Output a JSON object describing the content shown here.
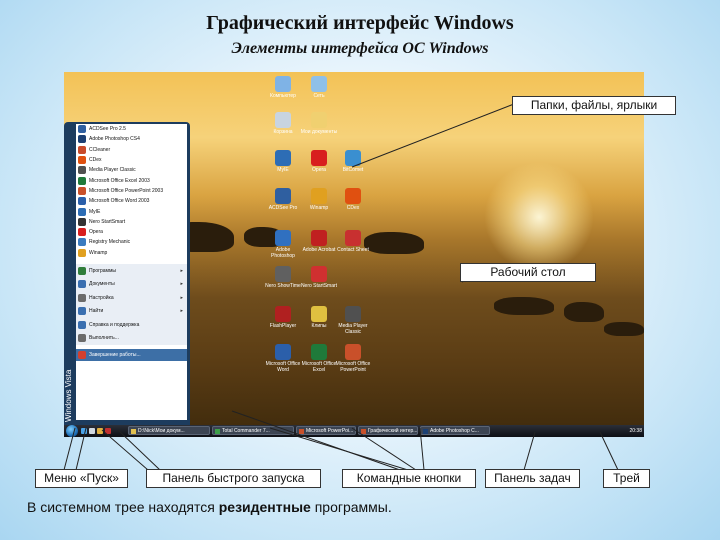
{
  "title": "Графический интерфейс Windows",
  "subtitle": "Элементы интерфейса ОС Windows",
  "desktop": {
    "icons": [
      {
        "label": "Компьютер",
        "color": "#7fb3e6"
      },
      {
        "label": "Сеть",
        "color": "#8fc0e8"
      },
      {
        "label": "Корзина",
        "color": "#c8d4e0"
      },
      {
        "label": "Мои документы",
        "color": "#f0d070"
      },
      {
        "label": "MyIE",
        "color": "#2d6db5"
      },
      {
        "label": "Opera",
        "color": "#d81e1e"
      },
      {
        "label": "BitComet",
        "color": "#3a8fd0"
      },
      {
        "label": "ACDSee Pro",
        "color": "#2f5fa0"
      },
      {
        "label": "Winamp",
        "color": "#e0a020"
      },
      {
        "label": "CDex",
        "color": "#e05010"
      },
      {
        "label": "Adobe Photoshop",
        "color": "#3070c0"
      },
      {
        "label": "Adobe Acrobat",
        "color": "#c02020"
      },
      {
        "label": "Contact Sheet",
        "color": "#c83030"
      },
      {
        "label": "Nero ShowTime",
        "color": "#606060"
      },
      {
        "label": "Nero StartSmart",
        "color": "#d03030"
      },
      {
        "label": "FlashPlayer",
        "color": "#b02020"
      },
      {
        "label": "Клипы",
        "color": "#e0c040"
      },
      {
        "label": "Media Player Classic",
        "color": "#505050"
      },
      {
        "label": "Microsoft Office Word",
        "color": "#2b5faa"
      },
      {
        "label": "Microsoft Office Excel",
        "color": "#1f7a3a"
      },
      {
        "label": "Microsoft Office PowerPoint",
        "color": "#c9502a"
      }
    ]
  },
  "start_menu": {
    "side_label": "Windows Vista",
    "items": [
      {
        "label": "ACDSee Pro 2.5",
        "color": "#2f5fa0"
      },
      {
        "label": "Adobe Photoshop CS4",
        "color": "#1b3f73"
      },
      {
        "label": "CCleaner",
        "color": "#c84a2a"
      },
      {
        "label": "CDex",
        "color": "#e05010"
      },
      {
        "label": "Media Player Classic",
        "color": "#505050"
      },
      {
        "label": "Microsoft Office Excel 2003",
        "color": "#1f7a3a"
      },
      {
        "label": "Microsoft Office PowerPoint 2003",
        "color": "#c9502a"
      },
      {
        "label": "Microsoft Office Word 2003",
        "color": "#2b5faa"
      },
      {
        "label": "MyIE",
        "color": "#2d6db5"
      },
      {
        "label": "Nero StartSmart",
        "color": "#333333"
      },
      {
        "label": "Opera",
        "color": "#d81e1e"
      },
      {
        "label": "Registry Mechanic",
        "color": "#3b7bbf"
      },
      {
        "label": "Winamp",
        "color": "#e0a020"
      }
    ],
    "lower_items": [
      {
        "label": "Программы",
        "arrow": "▸"
      },
      {
        "label": "Документы",
        "arrow": "▸"
      },
      {
        "label": "Настройка",
        "arrow": "▸"
      },
      {
        "label": "Найти",
        "arrow": "▸"
      },
      {
        "label": "Справка и поддержка",
        "arrow": ""
      },
      {
        "label": "Выполнить...",
        "arrow": ""
      }
    ],
    "shutdown": "Завершение работы..."
  },
  "taskbar": {
    "buttons": [
      {
        "label": "D:\\Nick\\Мои докум..."
      },
      {
        "label": "Total Commander 7..."
      },
      {
        "label": "Microsoft PowerPoi..."
      },
      {
        "label": "Графический интер..."
      },
      {
        "label": "Adobe Photoshop C..."
      }
    ],
    "clock": "20:38"
  },
  "callouts": {
    "folders": "Папки, файлы, ярлыки",
    "desktop": "Рабочий стол",
    "start_menu": "Меню «Пуск»",
    "quick_launch": "Панель быстрого запуска",
    "command_buttons": "Командные кнопки",
    "taskbar": "Панель задач",
    "tray": "Трей"
  },
  "bottom_text": {
    "prefix": "В системном трее находятся ",
    "bold": "резидентные",
    "suffix": " программы."
  }
}
